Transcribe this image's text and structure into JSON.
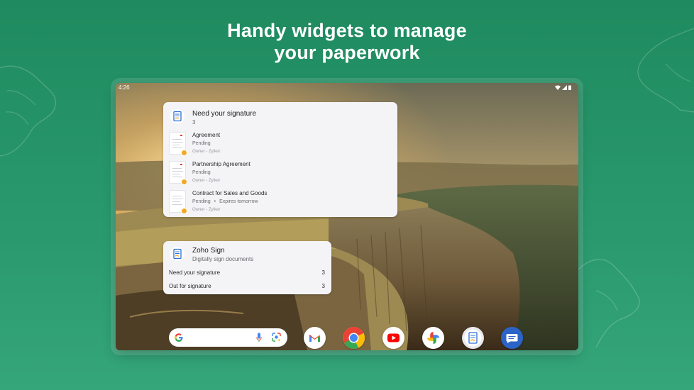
{
  "headline": {
    "line1": "Handy widgets to manage",
    "line2": "your paperwork"
  },
  "status_bar": {
    "time": "4:26",
    "icons": [
      "wifi-icon",
      "signal-icon",
      "battery-icon"
    ]
  },
  "signature_widget": {
    "title": "Need your signature",
    "count": "3",
    "items": [
      {
        "name": "Agreement",
        "status": "Pending",
        "expiry": "",
        "owner": "Owner - Zylker"
      },
      {
        "name": "Partnership Agreement",
        "status": "Pending",
        "expiry": "",
        "owner": "Owner - Zylker"
      },
      {
        "name": "Contract for Sales and Goods",
        "status": "Pending",
        "expiry": "Expires tomorrow",
        "owner": "Owner - Zylker"
      }
    ]
  },
  "zoho_widget": {
    "title": "Zoho Sign",
    "subtitle": "Digitally sign documents",
    "rows": [
      {
        "label": "Need your signature",
        "count": "3"
      },
      {
        "label": "Out for signature",
        "count": "3"
      }
    ]
  },
  "dock": {
    "apps": [
      "gmail-icon",
      "chrome-icon",
      "youtube-icon",
      "photos-icon",
      "zoho-sign-icon",
      "messages-icon"
    ]
  },
  "colors": {
    "background": "#1f8a5f",
    "widget_bg": "#f4f4f6",
    "pending_badge": "#f5a623"
  }
}
